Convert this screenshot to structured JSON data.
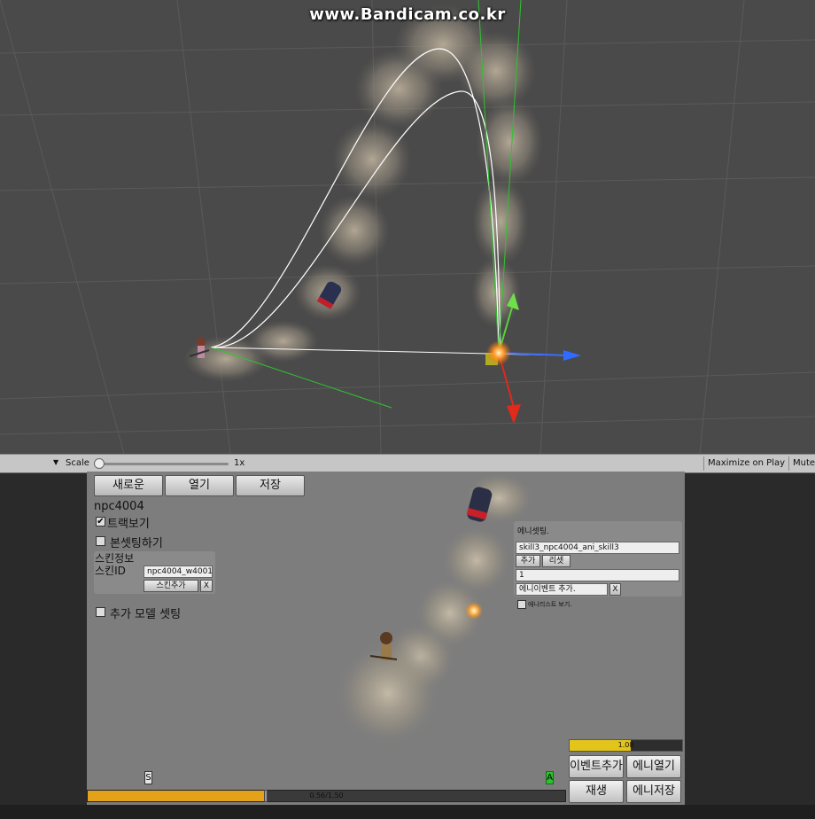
{
  "watermark": "www.Bandicam.co.kr",
  "scene_toolbar": {
    "scale_label": "Scale",
    "scale_value": "1x",
    "maximize_label": "Maximize on Play",
    "mute_label": "Mute",
    "scale_slider_level": 0
  },
  "game": {
    "buttons": {
      "new": "새로운",
      "open": "열기",
      "save": "저장"
    },
    "npc_name": "npc4004",
    "track_view": {
      "label": "트랙보기",
      "checked": true
    },
    "bone_setting": {
      "label": "본셋팅하기",
      "checked": false
    },
    "skin_panel": {
      "title": "스킨정보",
      "skin_id_label": "스킨ID",
      "skin_id_value": "npc4004_w4001",
      "add_skin_label": "스킨추가",
      "remove_label": "X"
    },
    "extra_model": {
      "label": "추가 모델 셋팅",
      "checked": false
    },
    "ani_panel": {
      "title": "에니셋팅.",
      "ani_name": "skill3_npc4004_ani_skill3",
      "add_label": "추가",
      "reset_label": "리셋",
      "count_value": "1",
      "add_event_field": "에니이벤트 추가.",
      "remove_label": "X",
      "ani_list_view": {
        "label": "에니리스트 보기.",
        "checked": false
      }
    },
    "timeline": {
      "marker_s": "S",
      "marker_a": "A",
      "progress_text": "0.56/1.50",
      "progress": 0.373,
      "accent": "#e3a21a"
    },
    "speed_bar": {
      "text": "1.08",
      "level": 0.54,
      "accent": "#e3c41a"
    },
    "action_buttons": {
      "add_event": "이벤트추가",
      "open_ani": "에니열기",
      "play": "재생",
      "save_ani": "에니저장"
    }
  }
}
